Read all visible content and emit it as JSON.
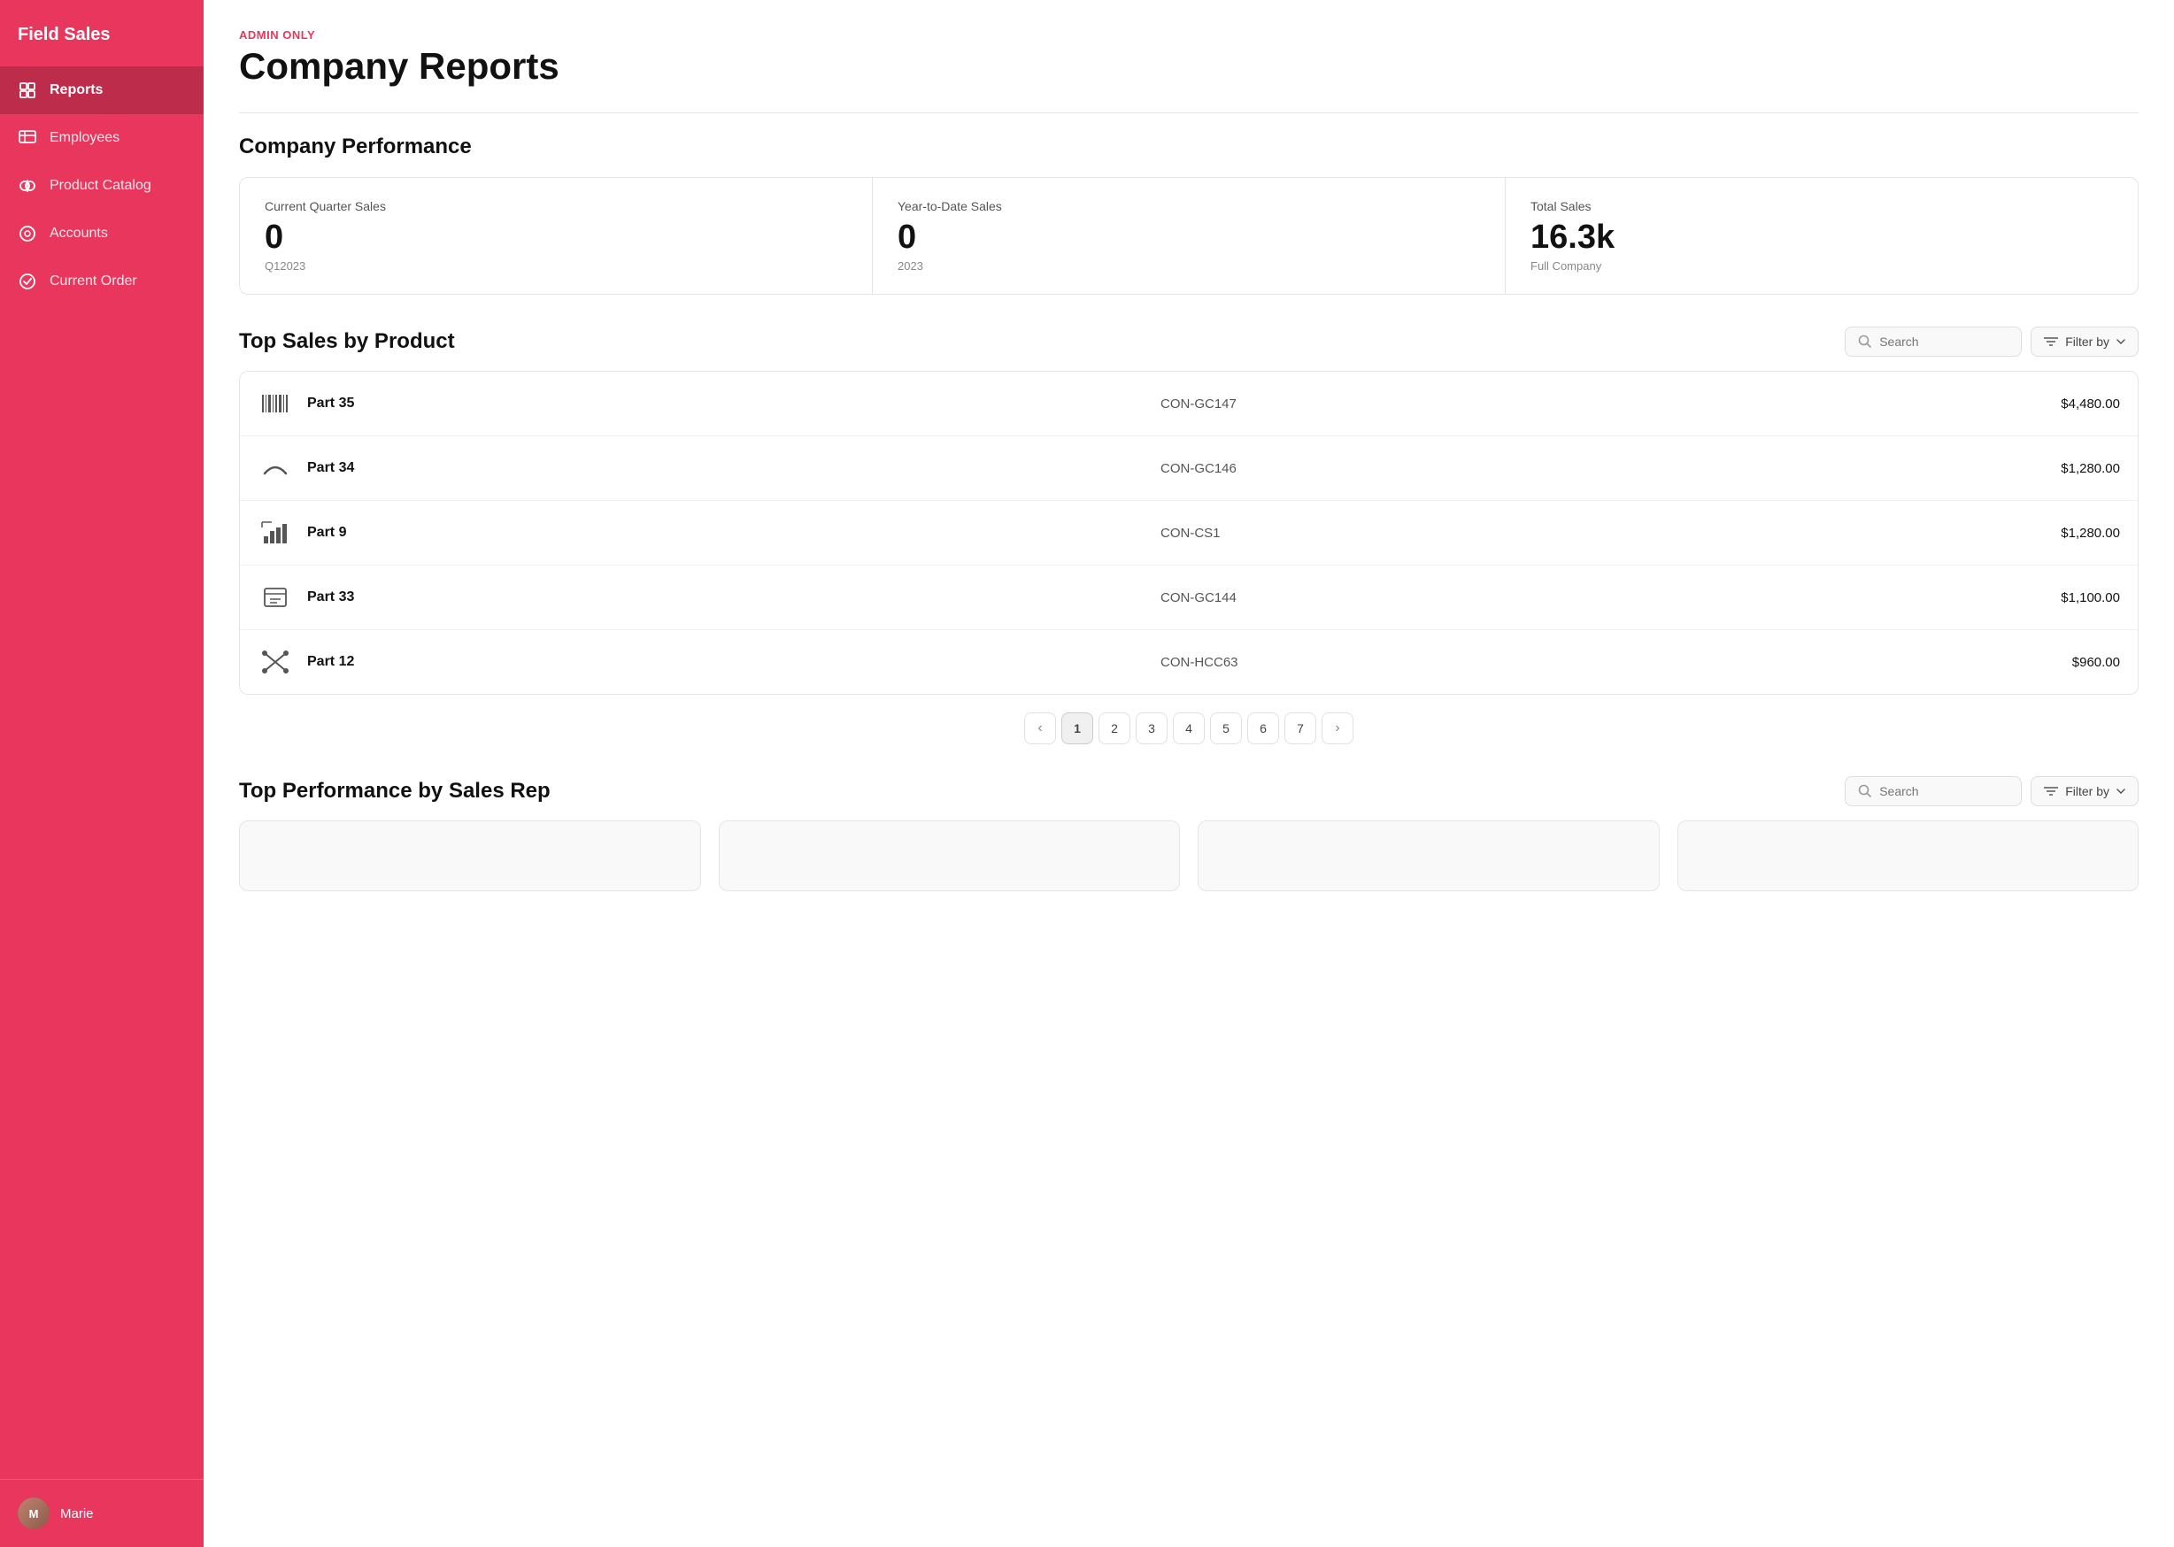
{
  "app": {
    "title": "Field Sales"
  },
  "sidebar": {
    "items": [
      {
        "id": "reports",
        "label": "Reports",
        "icon": "reports-icon",
        "active": true
      },
      {
        "id": "employees",
        "label": "Employees",
        "icon": "employees-icon",
        "active": false
      },
      {
        "id": "product-catalog",
        "label": "Product Catalog",
        "icon": "catalog-icon",
        "active": false
      },
      {
        "id": "accounts",
        "label": "Accounts",
        "icon": "accounts-icon",
        "active": false
      },
      {
        "id": "current-order",
        "label": "Current Order",
        "icon": "order-icon",
        "active": false
      }
    ],
    "user": {
      "name": "Marie"
    }
  },
  "header": {
    "admin_label": "ADMIN ONLY",
    "title": "Company Reports"
  },
  "performance": {
    "section_title": "Company Performance",
    "cards": [
      {
        "label": "Current Quarter Sales",
        "value": "0",
        "sub": "Q12023"
      },
      {
        "label": "Year-to-Date Sales",
        "value": "0",
        "sub": "2023"
      },
      {
        "label": "Total Sales",
        "value": "16.3k",
        "sub": "Full Company"
      }
    ]
  },
  "top_sales": {
    "section_title": "Top Sales by Product",
    "search_placeholder": "Search",
    "filter_label": "Filter by",
    "products": [
      {
        "name": "Part 35",
        "sku": "CON-GC147",
        "price": "$4,480.00",
        "icon": "barcode"
      },
      {
        "name": "Part 34",
        "sku": "CON-GC146",
        "price": "$1,280.00",
        "icon": "part-curve"
      },
      {
        "name": "Part 9",
        "sku": "CON-CS1",
        "price": "$1,280.00",
        "icon": "chart-bar"
      },
      {
        "name": "Part 33",
        "sku": "CON-GC144",
        "price": "$1,100.00",
        "icon": "panel"
      },
      {
        "name": "Part 12",
        "sku": "CON-HCC63",
        "price": "$960.00",
        "icon": "scissors"
      }
    ],
    "pagination": {
      "current": 1,
      "pages": [
        1,
        2,
        3,
        4,
        5,
        6,
        7
      ]
    }
  },
  "top_reps": {
    "section_title": "Top Performance by Sales Rep",
    "search_placeholder": "Search",
    "filter_label": "Filter by"
  }
}
